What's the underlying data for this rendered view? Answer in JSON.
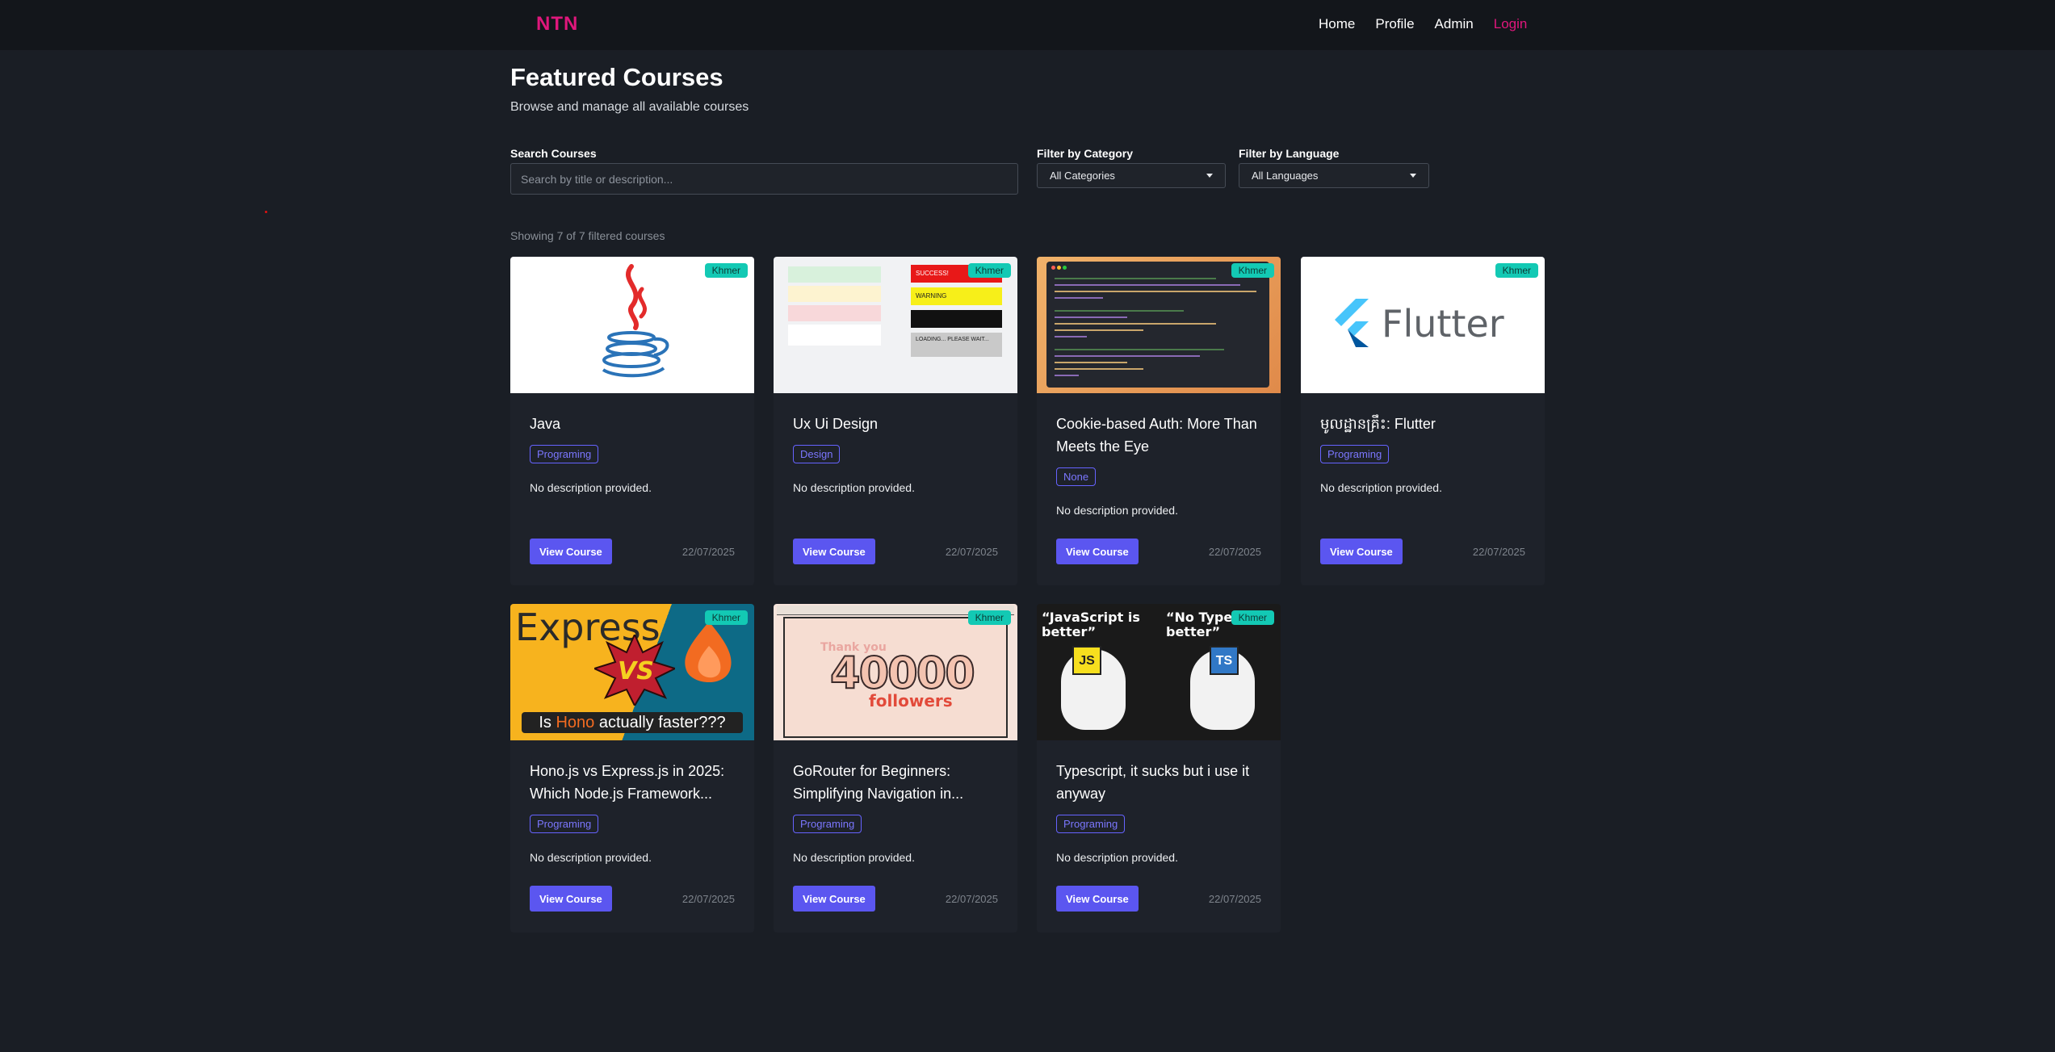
{
  "nav": {
    "brand": "NTN",
    "links": [
      "Home",
      "Profile",
      "Admin"
    ],
    "login": "Login"
  },
  "page": {
    "title": "Featured Courses",
    "subtitle": "Browse and manage all available courses"
  },
  "filters": {
    "search_label": "Search Courses",
    "search_placeholder": "Search by title or description...",
    "category_label": "Filter by Category",
    "category_value": "All Categories",
    "language_label": "Filter by Language",
    "language_value": "All Languages"
  },
  "count_text": "Showing 7 of 7 filtered courses",
  "colors": {
    "accent": "#e0177c",
    "button": "#5b56f0",
    "badge": "#13c9b4",
    "background": "#1a1e25"
  },
  "courses": [
    {
      "title": "Java",
      "language": "Khmer",
      "category": "Programing",
      "description": "No description provided.",
      "button": "View Course",
      "date": "22/07/2025",
      "image": "java-logo"
    },
    {
      "title": "Ux Ui Design",
      "language": "Khmer",
      "category": "Design",
      "description": "No description provided.",
      "button": "View Course",
      "date": "22/07/2025",
      "image": "ui-alerts-screenshot"
    },
    {
      "title": "Cookie-based Auth: More Than Meets the Eye",
      "language": "Khmer",
      "category": "None",
      "description": "No description provided.",
      "button": "View Course",
      "date": "22/07/2025",
      "image": "code-editor-screenshot"
    },
    {
      "title": "មូលដ្ឋានគ្រឹះ: Flutter",
      "language": "Khmer",
      "category": "Programing",
      "description": "No description provided.",
      "button": "View Course",
      "date": "22/07/2025",
      "image": "flutter-logo"
    },
    {
      "title": "Hono.js vs Express.js in 2025: Which Node.js Framework...",
      "language": "Khmer",
      "category": "Programing",
      "description": "No description provided.",
      "button": "View Course",
      "date": "22/07/2025",
      "image": "express-vs-hono"
    },
    {
      "title": "GoRouter for Beginners: Simplifying Navigation in...",
      "language": "Khmer",
      "category": "Programing",
      "description": "No description provided.",
      "button": "View Course",
      "date": "22/07/2025",
      "image": "40000-followers"
    },
    {
      "title": "Typescript, it sucks but i use it anyway",
      "language": "Khmer",
      "category": "Programing",
      "description": "No description provided.",
      "button": "View Course",
      "date": "22/07/2025",
      "image": "js-vs-ts-meme"
    }
  ],
  "image_text": {
    "express": {
      "word": "Express",
      "vs": "VS",
      "caption_pre": "Is ",
      "caption_hl": "Hono",
      "caption_post": " actually faster???"
    },
    "gorouter": {
      "thank": "Thank you",
      "number": "40000",
      "word": "followers"
    },
    "ts": {
      "left": "“JavaScript is better”",
      "right": "“No Type is better”",
      "js": "JS",
      "ts": "TS"
    },
    "flutter": {
      "word": "Flutter"
    },
    "ux": {
      "success": "SUCCESS!",
      "warning": "WARNING",
      "loading": "LOADING... PLEASE WAIT..."
    }
  }
}
